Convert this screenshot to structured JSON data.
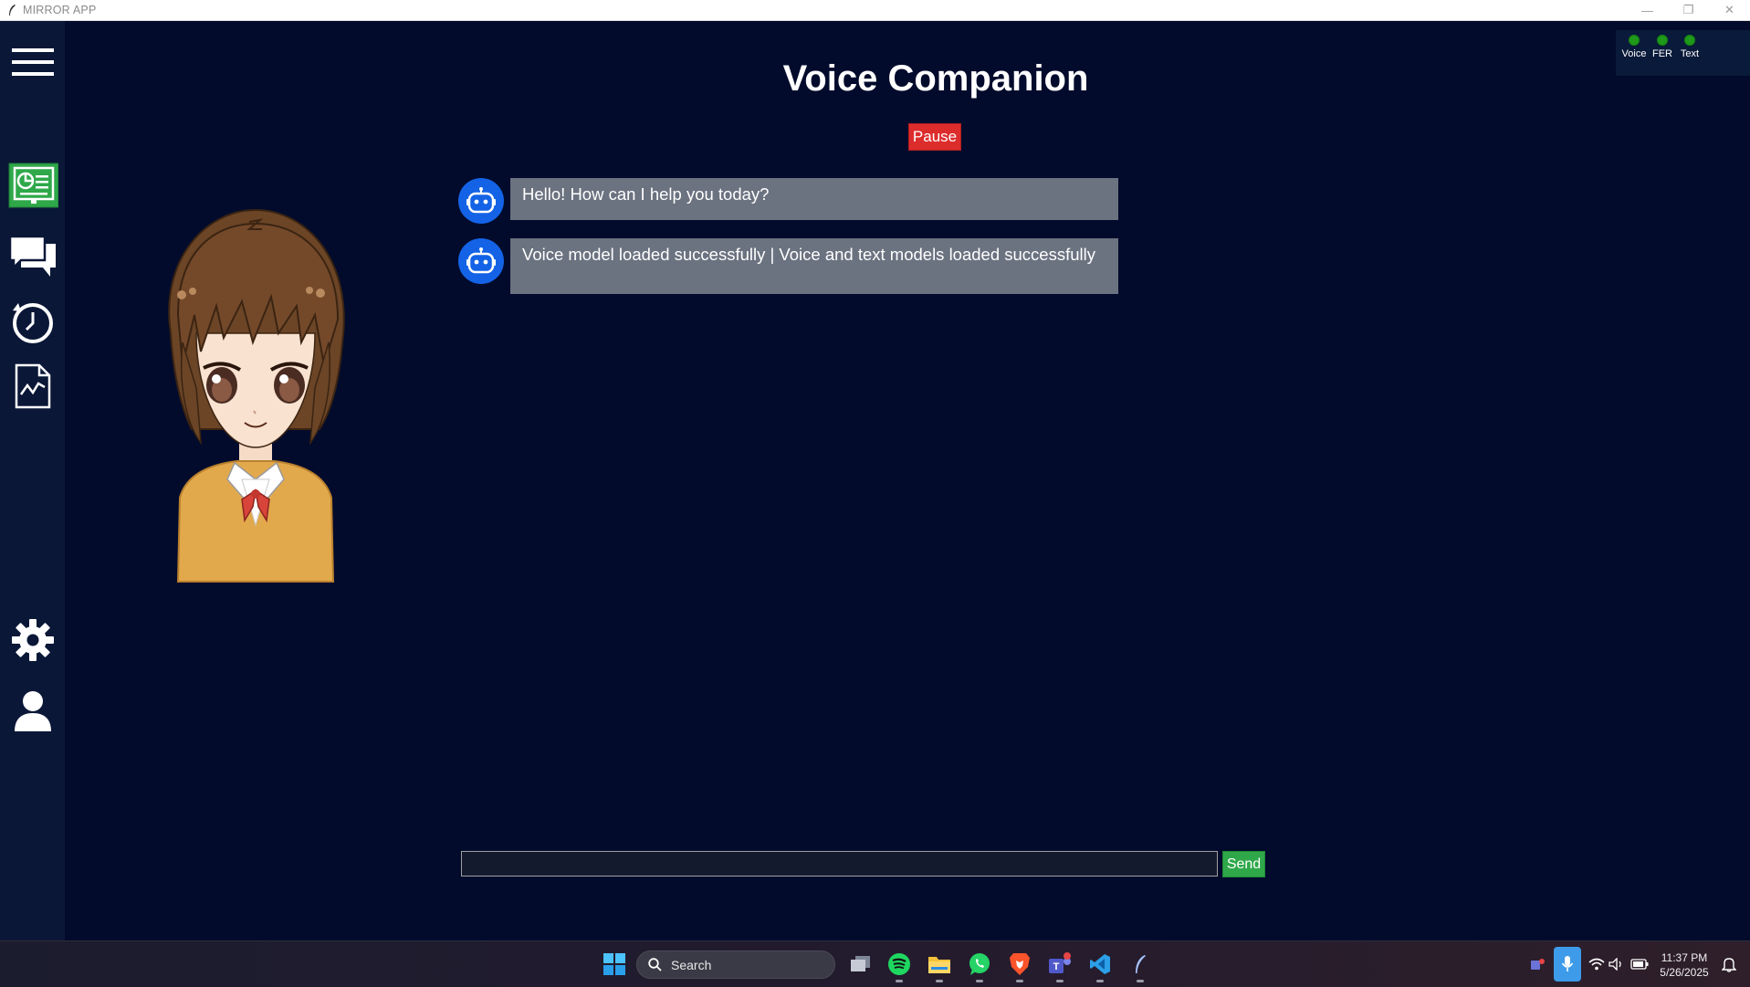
{
  "window": {
    "title": "MIRROR APP",
    "minimize_glyph": "—",
    "maximize_glyph": "❐",
    "close_glyph": "✕"
  },
  "sidebar": {
    "items": [
      {
        "name": "menu",
        "icon": "hamburger-menu-icon"
      },
      {
        "name": "dashboard",
        "icon": "dashboard-icon",
        "active": true
      },
      {
        "name": "chat",
        "icon": "chat-bubbles-icon"
      },
      {
        "name": "history",
        "icon": "clock-history-icon"
      },
      {
        "name": "reports",
        "icon": "chart-document-icon"
      },
      {
        "name": "settings",
        "icon": "gear-icon"
      },
      {
        "name": "profile",
        "icon": "user-icon"
      }
    ],
    "active_color": "#2fa84a"
  },
  "header": {
    "title": "Voice Companion",
    "pause_label": "Pause"
  },
  "status": {
    "items": [
      {
        "label": "Voice",
        "state": "on"
      },
      {
        "label": "FER",
        "state": "on"
      },
      {
        "label": "Text",
        "state": "on"
      }
    ],
    "on_color": "#1f9a1a"
  },
  "chat": {
    "messages": [
      {
        "sender": "bot",
        "text": "Hello! How can I help you today?"
      },
      {
        "sender": "bot",
        "text": "Voice model loaded successfully | Voice and text models loaded successfully"
      }
    ],
    "input_value": "",
    "send_label": "Send"
  },
  "taskbar": {
    "search_placeholder": "Search",
    "apps": [
      "windows-start-icon",
      "task-view-icon",
      "spotify-icon",
      "file-explorer-icon",
      "whatsapp-icon",
      "brave-browser-icon",
      "teams-icon",
      "vscode-icon",
      "mirror-app-icon"
    ],
    "time": "11:37 PM",
    "date": "5/26/2025"
  },
  "colors": {
    "background": "#020b2c",
    "sidebar": "#0a1737",
    "pause": "#dd2c2c",
    "send": "#2fa84a",
    "bubble": "#6b7280",
    "bot_avatar": "#1463e6"
  }
}
